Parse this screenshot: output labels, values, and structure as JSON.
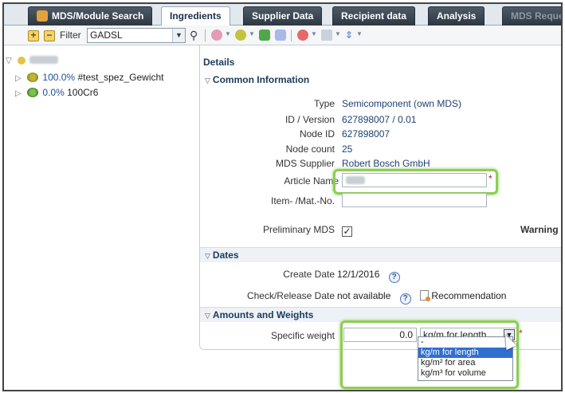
{
  "tabs": [
    {
      "label": "MDS/Module Search",
      "state": "normal"
    },
    {
      "label": "Ingredients",
      "state": "active"
    },
    {
      "label": "Supplier Data",
      "state": "normal"
    },
    {
      "label": "Recipient data",
      "state": "normal"
    },
    {
      "label": "Analysis",
      "state": "normal"
    },
    {
      "label": "MDS Request",
      "state": "disabled"
    }
  ],
  "toolbar": {
    "filter_label": "Filter",
    "filter_value": "GADSL"
  },
  "tree": {
    "rows": [
      {
        "percent": "100.0%",
        "name": "#test_spez_Gewicht"
      },
      {
        "percent": "0.0%",
        "name": "100Cr6"
      }
    ]
  },
  "details": {
    "title": "Details",
    "common": {
      "header": "Common Information",
      "type_label": "Type",
      "type_value": "Semicomponent (own MDS)",
      "id_label": "ID / Version",
      "id_value": "627898007 / 0.01",
      "node_id_label": "Node ID",
      "node_id_value": "627898007",
      "node_count_label": "Node count",
      "node_count_value": "25",
      "supplier_label": "MDS Supplier",
      "supplier_value": "Robert Bosch GmbH",
      "article_label": "Article Name",
      "item_label": "Item- /Mat.-No.",
      "preliminary_label": "Preliminary MDS",
      "preliminary_checked": true,
      "warning": "Warning"
    },
    "dates": {
      "header": "Dates",
      "create_label": "Create Date",
      "create_value": "12/1/2016",
      "release_label": "Check/Release Date",
      "release_value": "not available",
      "recommendation": "Recommendation"
    },
    "weights": {
      "header": "Amounts and Weights",
      "specific_label": "Specific weight",
      "specific_value": "0.0",
      "unit_selected": "kg/m for length",
      "unit_options": [
        "-",
        "kg/m for length",
        "kg/m² for area",
        "kg/m³ for volume"
      ]
    }
  },
  "colors": {
    "highlight": "#8dcc55",
    "dropdown_selected": "#2f6fd1"
  }
}
